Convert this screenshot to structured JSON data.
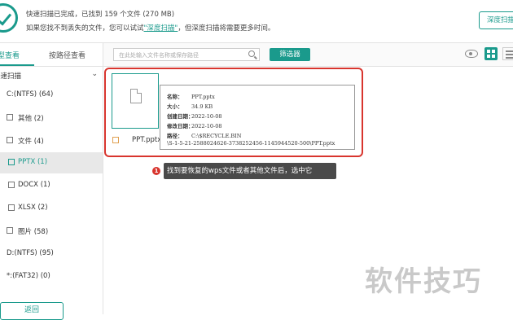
{
  "header": {
    "status_line1": "快速扫描已完成，已找到 159 个文件 (270 MB)",
    "status_line2_pre": "如果您找不到丢失的文件，您可以试试",
    "status_line2_link": "\"深度扫描\"",
    "status_line2_post": "，但深度扫描将需要更多时间。",
    "deep_scan_button": "深度扫描"
  },
  "sidebar": {
    "tabs": [
      {
        "label": "类型查看",
        "active": true
      },
      {
        "label": "按路径查看",
        "active": false
      }
    ],
    "group_label": "快速扫描",
    "tree": [
      {
        "label": "C:(NTFS) (64)",
        "selected": false
      },
      {
        "label": "其他 (2)",
        "selected": false
      },
      {
        "label": "文件 (4)",
        "selected": false
      },
      {
        "label": "PPTX (1)",
        "selected": true
      },
      {
        "label": "DOCX (1)",
        "selected": false
      },
      {
        "label": "XLSX (2)",
        "selected": false
      },
      {
        "label": "图片 (58)",
        "selected": false
      },
      {
        "label": "D:(NTFS) (95)",
        "selected": false
      },
      {
        "label": "*:(FAT32) (0)",
        "selected": false
      }
    ],
    "back_button": "返回"
  },
  "toolbar": {
    "search_placeholder": "在此处输入文件名称或保存路径",
    "filter_button": "筛选器"
  },
  "file": {
    "name": "PPT.pptx",
    "tooltip": {
      "name_label": "名称：",
      "name_value": "PPT.pptx",
      "size_label": "大小：",
      "size_value": "34.9 KB",
      "created_label": "创建日期：",
      "created_value": "2022-10-08",
      "modified_label": "修改日期：",
      "modified_value": "2022-10-08",
      "path_label": "路径：",
      "path_value": "C:\\$RECYCLE.BIN",
      "path_value2": "\\S-1-5-21-2588024626-3738252456-1145944520-500\\PPT.pptx"
    }
  },
  "annotation": {
    "number": "1",
    "text": "找到要恢复的wps文件或者其他文件后，选中它"
  },
  "watermark": "软件技巧",
  "colors": {
    "accent": "#1a9a8c",
    "highlight": "#d8352e"
  }
}
